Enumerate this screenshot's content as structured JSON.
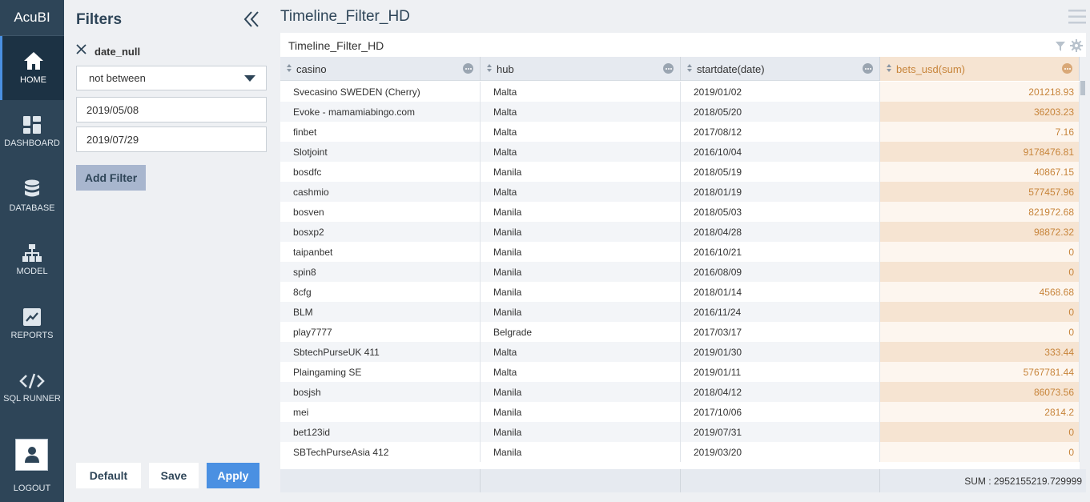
{
  "app": {
    "brand": "AcuBI"
  },
  "nav": {
    "items": [
      {
        "label": "HOME",
        "icon": "home-icon",
        "active": true
      },
      {
        "label": "DASHBOARD",
        "icon": "dashboard-icon",
        "active": false
      },
      {
        "label": "DATABASE",
        "icon": "database-icon",
        "active": false
      },
      {
        "label": "MODEL",
        "icon": "model-icon",
        "active": false
      },
      {
        "label": "REPORTS",
        "icon": "reports-icon",
        "active": false
      },
      {
        "label": "SQL RUNNER",
        "icon": "code-icon",
        "active": false
      }
    ],
    "logout_label": "LOGOUT"
  },
  "filters": {
    "title": "Filters",
    "filter_name": "date_null",
    "operator": "not between",
    "value_from": "2019/05/08",
    "value_to": "2019/07/29",
    "add_label": "Add Filter",
    "default_label": "Default",
    "save_label": "Save",
    "apply_label": "Apply"
  },
  "main": {
    "page_title": "Timeline_Filter_HD",
    "card_title": "Timeline_Filter_HD"
  },
  "table": {
    "columns": [
      "casino",
      "hub",
      "startdate(date)",
      "bets_usd(sum)"
    ],
    "rows": [
      [
        "Svecasino SWEDEN (Cherry)",
        "Malta",
        "2019/01/02",
        "201218.93"
      ],
      [
        "Evoke - mamamiabingo.com",
        "Malta",
        "2018/05/20",
        "36203.23"
      ],
      [
        "finbet",
        "Malta",
        "2017/08/12",
        "7.16"
      ],
      [
        "Slotjoint",
        "Malta",
        "2016/10/04",
        "9178476.81"
      ],
      [
        "bosdfc",
        "Manila",
        "2018/05/19",
        "40867.15"
      ],
      [
        "cashmio",
        "Malta",
        "2018/01/19",
        "577457.96"
      ],
      [
        "bosven",
        "Manila",
        "2018/05/03",
        "821972.68"
      ],
      [
        "bosxp2",
        "Manila",
        "2018/04/28",
        "98872.32"
      ],
      [
        "taipanbet",
        "Manila",
        "2016/10/21",
        "0"
      ],
      [
        "spin8",
        "Manila",
        "2016/08/09",
        "0"
      ],
      [
        "8cfg",
        "Manila",
        "2018/01/14",
        "4568.68"
      ],
      [
        "BLM",
        "Manila",
        "2016/11/24",
        "0"
      ],
      [
        "play7777",
        "Belgrade",
        "2017/03/17",
        "0"
      ],
      [
        "SbtechPurseUK 411",
        "Malta",
        "2019/01/30",
        "333.44"
      ],
      [
        "Plaingaming SE",
        "Malta",
        "2019/01/11",
        "5767781.44"
      ],
      [
        "bosjsh",
        "Manila",
        "2018/04/12",
        "86073.56"
      ],
      [
        "mei",
        "Manila",
        "2017/10/06",
        "2814.2"
      ],
      [
        "bet123id",
        "Manila",
        "2019/07/31",
        "0"
      ],
      [
        "SBTechPurseAsia 412",
        "Manila",
        "2019/03/20",
        "0"
      ]
    ],
    "sum_text": "SUM : 2952155219.729999"
  }
}
